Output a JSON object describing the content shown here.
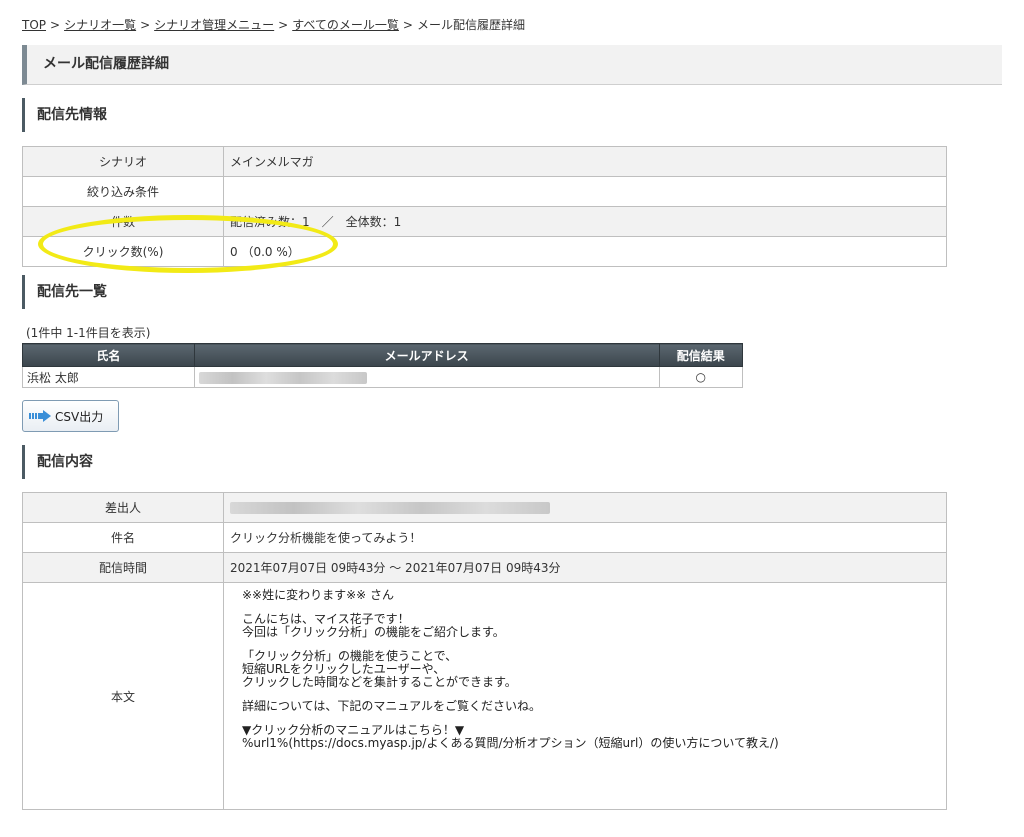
{
  "breadcrumb": {
    "items": [
      "TOP",
      "シナリオ一覧",
      "シナリオ管理メニュー",
      "すべてのメール一覧"
    ],
    "current": "メール配信履歴詳細",
    "separator": ">"
  },
  "page_title": "メール配信履歴詳細",
  "recipient_info": {
    "title": "配信先情報",
    "rows": [
      {
        "label": "シナリオ",
        "value": "メインメルマガ"
      },
      {
        "label": "絞り込み条件",
        "value": ""
      },
      {
        "label": "件数",
        "value": "配信済み数：1　／　全体数：1"
      },
      {
        "label": "クリック数(%)",
        "value": "0 （0.0 %）"
      }
    ]
  },
  "recipient_list": {
    "title": "配信先一覧",
    "count_text": "(1件中 1-1件目を表示)",
    "headers": [
      "氏名",
      "メールアドレス",
      "配信結果"
    ],
    "rows": [
      {
        "name": "浜松 太郎",
        "result": "○"
      }
    ]
  },
  "csv_button": {
    "label": "CSV出力",
    "icon": "arrow-right-icon"
  },
  "content": {
    "title": "配信内容",
    "sender_label": "差出人",
    "subject_label": "件名",
    "subject": "クリック分析機能を使ってみよう！",
    "time_label": "配信時間",
    "time": "2021年07月07日 09時43分 ～ 2021年07月07日 09時43分",
    "body_label": "本文",
    "body_lines": [
      "※※姓に変わります※※ さん",
      "こんにちは、マイス花子です！\n今回は「クリック分析」の機能をご紹介します。",
      "「クリック分析」の機能を使うことで、\n短縮URLをクリックしたユーザーや、\nクリックした時間などを集計することができます。",
      "詳細については、下記のマニュアルをご覧くださいね。",
      "▼クリック分析のマニュアルはこちら！▼\n%url1%(https://docs.myasp.jp/よくある質問/分析オプション（短縮url）の使い方について教え/)"
    ]
  },
  "colors": {
    "header_dark": "#3b454c",
    "accent_border": "#4b5a63",
    "highlight": "#f2ea16",
    "row_gray": "#f2f2f2"
  }
}
